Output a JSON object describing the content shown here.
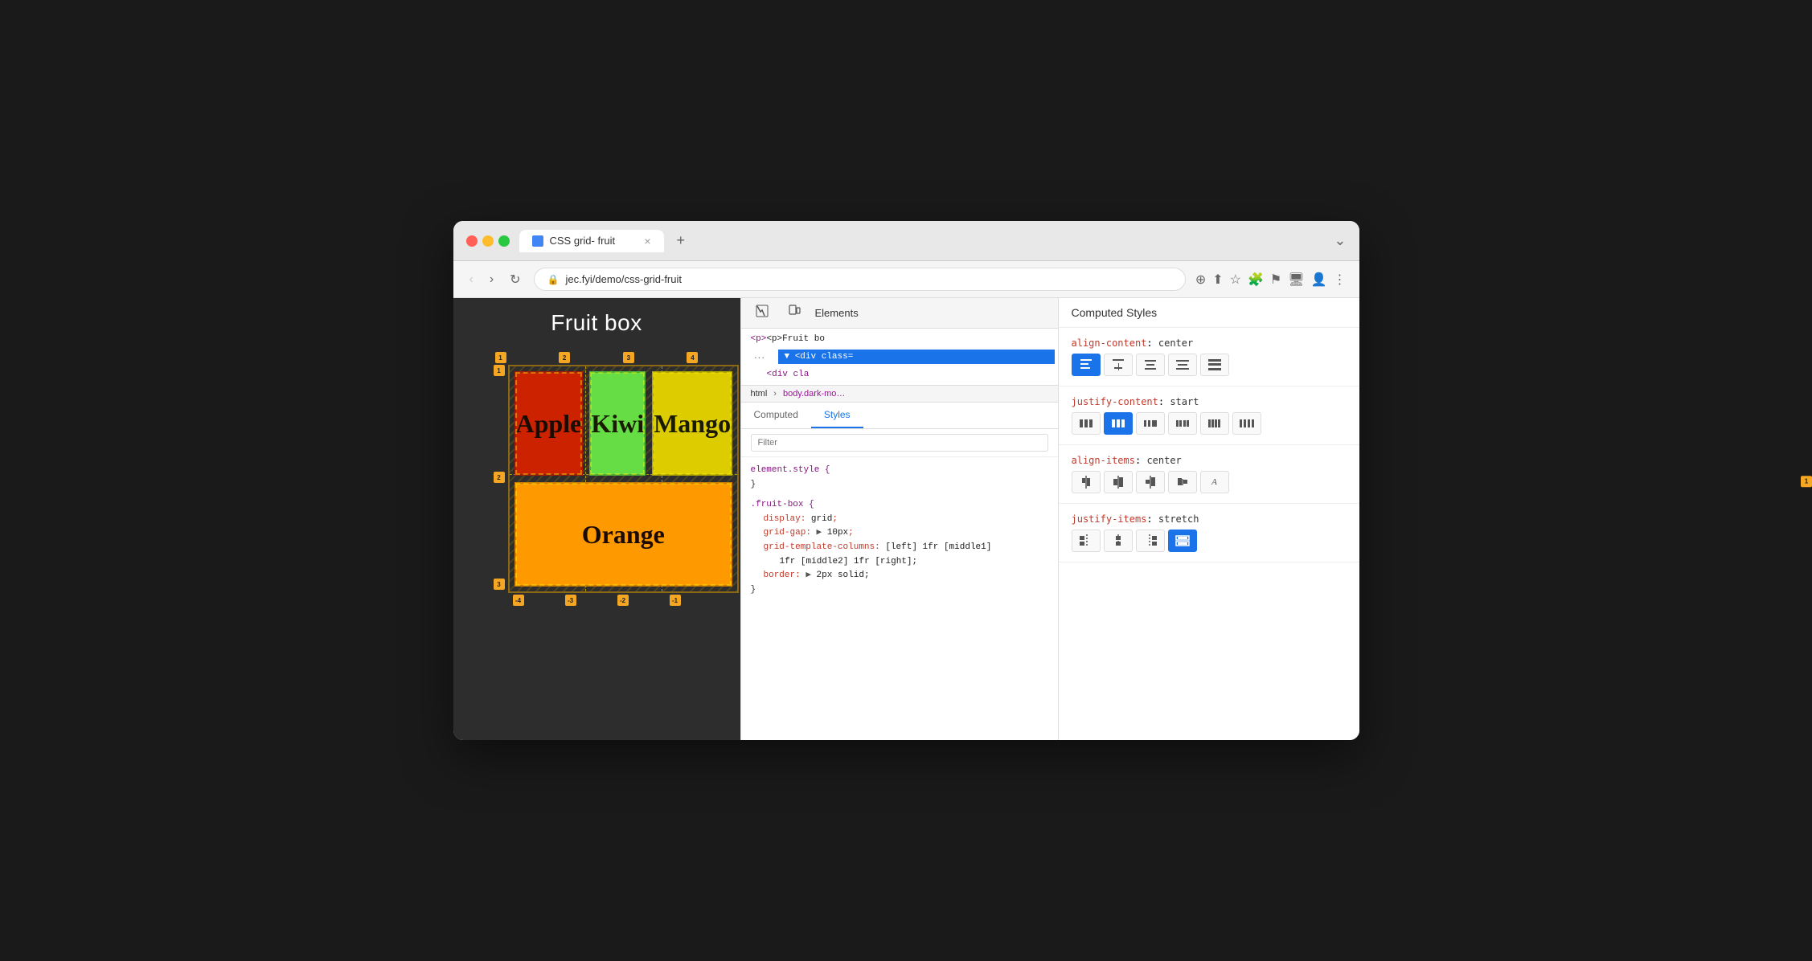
{
  "browser": {
    "tab_title": "CSS grid- fruit",
    "url": "jec.fyi/demo/css-grid-fruit",
    "tab_close": "×",
    "new_tab": "+"
  },
  "webpage": {
    "title": "Fruit box",
    "fruits": [
      {
        "name": "Apple",
        "color": "#cc2200"
      },
      {
        "name": "Kiwi",
        "color": "#55cc33"
      },
      {
        "name": "Mango",
        "color": "#ddcc00"
      },
      {
        "name": "Orange",
        "color": "#ff9900"
      }
    ]
  },
  "devtools": {
    "panel_label": "Elements",
    "html_line": "<p>Fruit bo",
    "div_line1": "<div class=",
    "div_line2": "<div cla",
    "breadcrumb": [
      "html",
      "body.dark-mo…"
    ],
    "tabs": [
      "Computed",
      "Styles"
    ],
    "active_tab": "Styles",
    "filter_placeholder": "Filter",
    "style_rules": [
      {
        "selector": "element.style {",
        "close": "}",
        "props": []
      },
      {
        "selector": ".fruit-box {",
        "close": "}",
        "props": [
          {
            "name": "display",
            "value": "grid"
          },
          {
            "name": "grid-gap",
            "value": "▶ 10px"
          },
          {
            "name": "grid-template-columns",
            "value": "[left] 1fr [middle1]\n      1fr [middle2] 1fr [right]"
          },
          {
            "name": "border",
            "value": "▶ 2px solid"
          }
        ]
      }
    ]
  },
  "computed_styles": {
    "header": "Computed Styles",
    "sections": [
      {
        "prop": "align-content",
        "value": "center",
        "buttons": [
          {
            "icon": "≡",
            "active": true,
            "label": "align-content-start"
          },
          {
            "icon": "⊟",
            "active": false,
            "label": "align-content-center"
          },
          {
            "icon": "≡",
            "active": false,
            "label": "align-content-end"
          },
          {
            "icon": "⊞",
            "active": false,
            "label": "align-content-space-between"
          },
          {
            "icon": "⊡",
            "active": false,
            "label": "align-content-space-around"
          }
        ]
      },
      {
        "prop": "justify-content",
        "value": "start",
        "buttons": [
          {
            "icon": "⊞",
            "active": false,
            "label": "justify-content-start"
          },
          {
            "icon": "⊟",
            "active": true,
            "label": "justify-content-center"
          },
          {
            "icon": "⊠",
            "active": false,
            "label": "justify-content-end"
          },
          {
            "icon": "⊡",
            "active": false,
            "label": "justify-content-space-between"
          },
          {
            "icon": "⊞",
            "active": false,
            "label": "justify-content-space-around"
          },
          {
            "icon": "⊟",
            "active": false,
            "label": "justify-content-space-evenly"
          }
        ]
      },
      {
        "prop": "align-items",
        "value": "center",
        "buttons": [
          {
            "icon": "⊕",
            "active": false,
            "label": "align-items-start"
          },
          {
            "icon": "≣",
            "active": false,
            "label": "align-items-center"
          },
          {
            "icon": "⊥",
            "active": false,
            "label": "align-items-end"
          },
          {
            "icon": "∥",
            "active": false,
            "label": "align-items-baseline"
          },
          {
            "icon": "A",
            "active": false,
            "label": "align-items-stretch"
          }
        ]
      },
      {
        "prop": "justify-items",
        "value": "stretch",
        "buttons": [
          {
            "icon": "⊞",
            "active": false,
            "label": "justify-items-start"
          },
          {
            "icon": "⊟",
            "active": false,
            "label": "justify-items-center"
          },
          {
            "icon": "⊠",
            "active": false,
            "label": "justify-items-end"
          },
          {
            "icon": "⊡",
            "active": true,
            "label": "justify-items-stretch"
          }
        ]
      }
    ]
  }
}
